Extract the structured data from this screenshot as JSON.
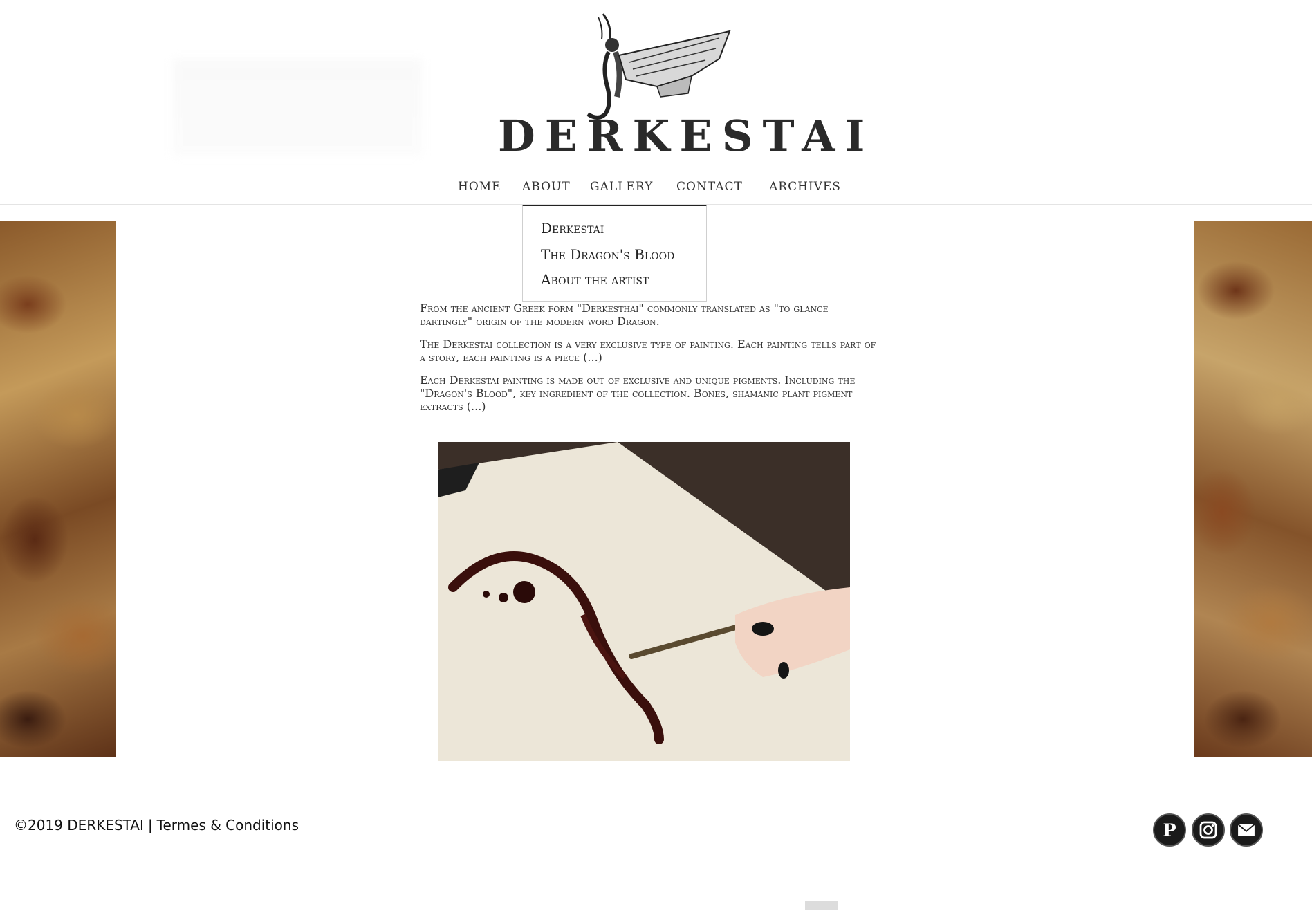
{
  "header": {
    "brand": "DERKESTAI"
  },
  "nav": {
    "items": [
      {
        "label": "HOME"
      },
      {
        "label": "ABOUT"
      },
      {
        "label": "GALLERY"
      },
      {
        "label": "CONTACT"
      },
      {
        "label": "ARCHIVES"
      }
    ]
  },
  "dropdown": {
    "items": [
      {
        "label": "Derkestai"
      },
      {
        "label": "The Dragon's Blood"
      },
      {
        "label": "About the artist"
      }
    ]
  },
  "content": {
    "paragraphs": [
      "From the ancient Greek form \"Derkesthai\" commonly translated as \"to glance dartingly\" origin of the modern word Dragon.",
      "The Derkestai collection is a very exclusive type of painting. Each painting tells part of a story, each painting is a piece (...)",
      "Each Derkestai painting is made out of exclusive and unique pigments. Including the \"Dragon's Blood\", key ingredient of the collection. Bones, shamanic plant pigment extracts (...)"
    ]
  },
  "footer": {
    "copyright": "©2019 DERKESTAI",
    "separator": "|",
    "terms": "Termes & Conditions"
  },
  "social": [
    {
      "icon": "pinterest-icon"
    },
    {
      "icon": "instagram-icon"
    },
    {
      "icon": "mail-icon"
    }
  ]
}
